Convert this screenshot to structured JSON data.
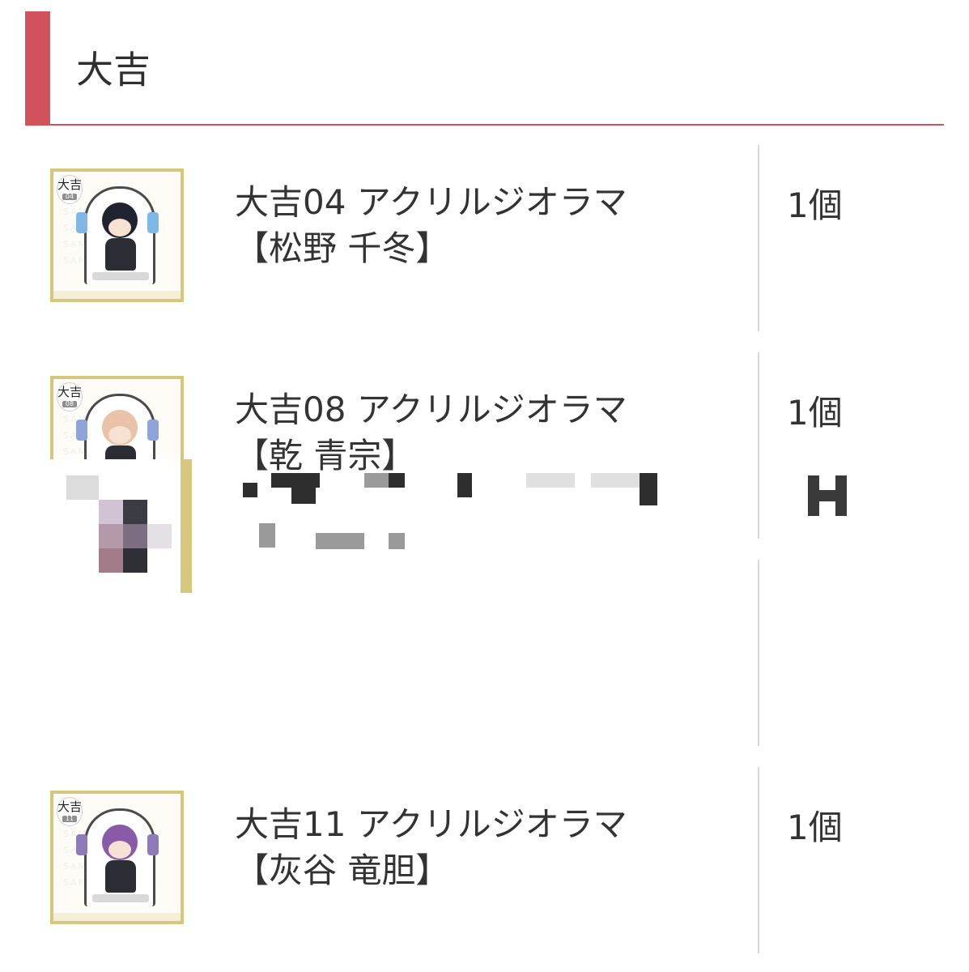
{
  "section": {
    "title": "大吉"
  },
  "colors": {
    "accent": "#d2525c",
    "thumb_frame": "#d7c77e",
    "divider": "#d6d6d6",
    "text": "#333333"
  },
  "items": [
    {
      "name_line1": "大吉04 アクリルジオラマ",
      "name_line2": "【松野 千冬】",
      "quantity": "1個",
      "badge": "大吉",
      "badge_num": "04",
      "hair_color": "#1f2430",
      "ribbon_color": "#7fb8e6"
    },
    {
      "name_line1": "大吉08 アクリルジオラマ",
      "name_line2": "【乾 青宗】",
      "quantity": "1個",
      "badge": "大吉",
      "badge_num": "08",
      "hair_color": "#e9c2a8",
      "ribbon_color": "#8fa4d8"
    },
    {
      "name_line1": "",
      "name_line2": "",
      "quantity": "",
      "pixelated": true
    },
    {
      "name_line1": "大吉11 アクリルジオラマ",
      "name_line2": "【灰谷 竜胆】",
      "quantity": "1個",
      "badge": "大吉",
      "badge_num": "11",
      "hair_color": "#8a5aa8",
      "ribbon_color": "#8f7ab8"
    }
  ]
}
